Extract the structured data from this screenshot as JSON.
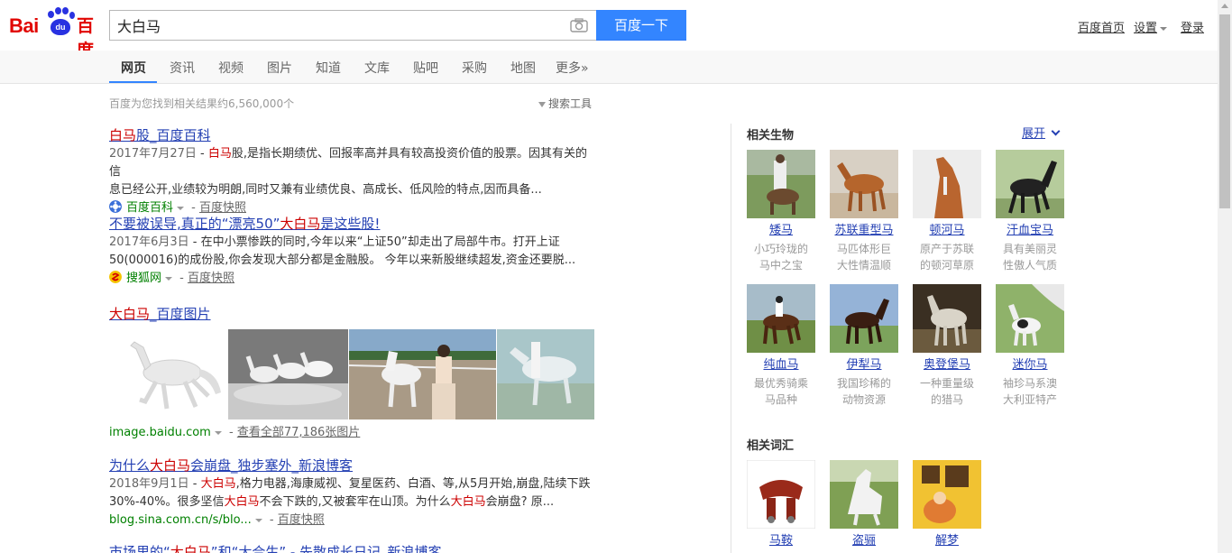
{
  "header": {
    "logo_left": "Bai",
    "logo_du": "du",
    "logo_right": "百度",
    "query": "大白马",
    "search_button": "百度一下",
    "links": {
      "home": "百度首页",
      "settings": "设置",
      "login": "登录"
    }
  },
  "tabs": [
    "网页",
    "资讯",
    "视频",
    "图片",
    "知道",
    "文库",
    "贴吧",
    "采购",
    "地图",
    "更多»"
  ],
  "stats": "百度为您找到相关结果约6,560,000个",
  "tools": "搜索工具",
  "results": [
    {
      "title_red": "白马",
      "title_rest": "股_百度百科",
      "date": "2017年7月27日",
      "abs_line1_pre": " - ",
      "abs_line1_red": "白马",
      "abs_line1_rest": "股,是指长期绩优、回报率高并具有较高投资价值的股票。因其有关的信",
      "abs_line2": "息已经公开,业绩较为明朗,同时又兼有业绩优良、高成长、低风险的特点,因而具备...",
      "source": "百度百科",
      "snapshot": "百度快照"
    },
    {
      "title_pre": "不要被误导,真正的“漂亮50”",
      "title_red": "大白马",
      "title_rest": "是这些股!",
      "date": "2017年6月3日",
      "abs_line1": " - 在中小票惨跌的同时,今年以来“上证50”却走出了局部牛市。打开上证",
      "abs_line2": "50(000016)的成份股,你会发现大部分都是金融股。 今年以来新股继续超发,资金还要脱...",
      "source": "搜狐网",
      "snapshot": "百度快照"
    },
    {
      "title_red": "大白马",
      "title_rest": "_百度图片",
      "source": "image.baidu.com",
      "more_link": "查看全部77,186张图片"
    },
    {
      "title_pre": "为什么",
      "title_red": "大白马",
      "title_rest": "会崩盘_独步塞外_新浪博客",
      "date": "2018年9月1日",
      "abs_line1_pre": " - ",
      "abs_line1_red": "大白马",
      "abs_line1_rest": ",格力电器,海康威视、复星医药、白酒、等,从5月开始,崩盘,陆续下跌",
      "abs_line2_a": "30%-40%。很多坚信",
      "abs_line2_red1": "大白马",
      "abs_line2_b": "不会下跌的,又被套牢在山顶。为什么",
      "abs_line2_red2": "大白马",
      "abs_line2_c": "会崩盘? 原...",
      "source": "blog.sina.com.cn/s/blo...",
      "snapshot": "百度快照"
    },
    {
      "title_pre": "市场里的“",
      "title_red": "大白马",
      "title_rest": "”和“大合生” - 先散成长日记_新浪博客"
    }
  ],
  "sidebar": {
    "section1_title": "相关生物",
    "expand": "展开",
    "animals": [
      {
        "name": "矮马",
        "desc1": "小巧玲珑的",
        "desc2": "马中之宝"
      },
      {
        "name": "苏联重型马",
        "desc1": "马匹体形巨",
        "desc2": "大性情温顺"
      },
      {
        "name": "顿河马",
        "desc1": "原产于苏联",
        "desc2": "的顿河草原"
      },
      {
        "name": "汗血宝马",
        "desc1": "具有美丽灵",
        "desc2": "性傲人气质"
      },
      {
        "name": "纯血马",
        "desc1": "最优秀骑乘",
        "desc2": "马品种"
      },
      {
        "name": "伊犁马",
        "desc1": "我国珍稀的",
        "desc2": "动物资源"
      },
      {
        "name": "奥登堡马",
        "desc1": "一种重量级",
        "desc2": "的猎马"
      },
      {
        "name": "迷你马",
        "desc1": "袖珍马系澳",
        "desc2": "大利亚特产"
      }
    ],
    "section2_title": "相关词汇",
    "words": [
      {
        "name": "马鞍"
      },
      {
        "name": "盗骊"
      },
      {
        "name": "解梦"
      }
    ]
  },
  "colors": {
    "accent": "#3385ff",
    "link": "#2440b3",
    "highlight": "#c00000",
    "source_green": "#008000"
  }
}
